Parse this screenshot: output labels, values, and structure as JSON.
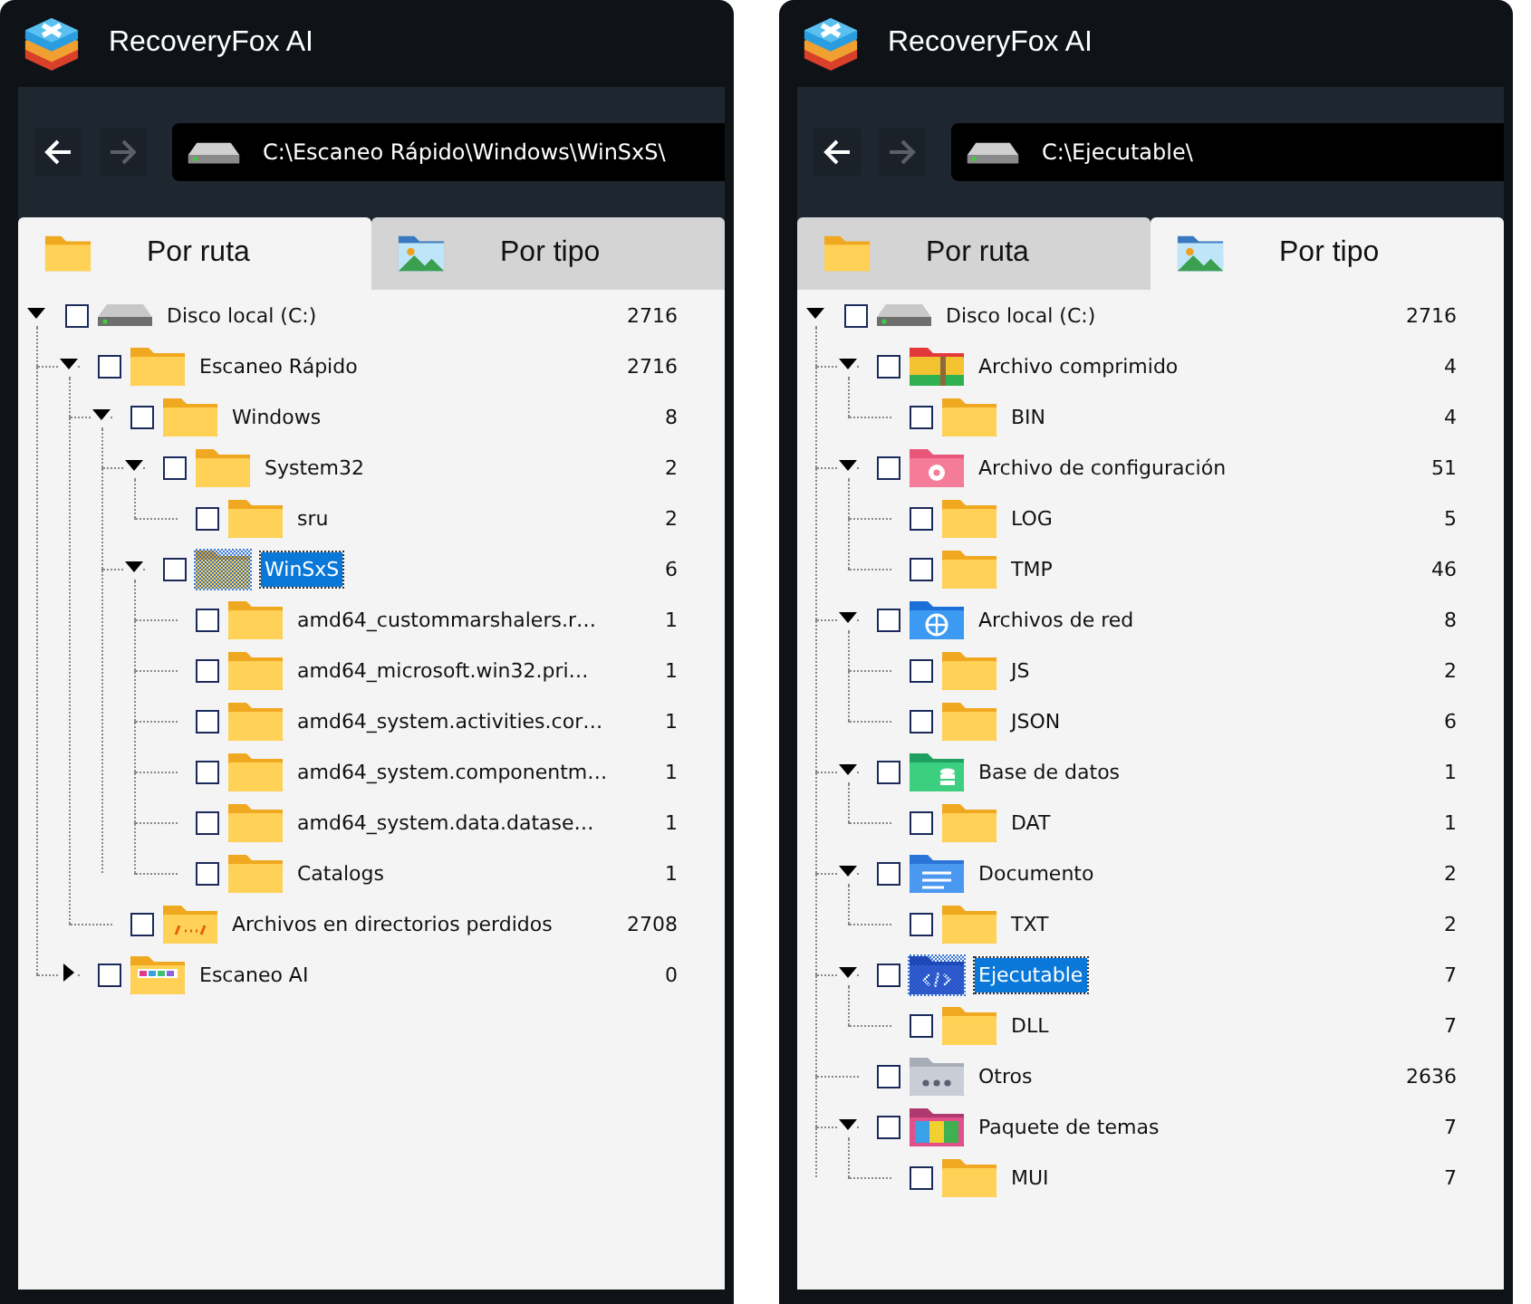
{
  "panels": [
    {
      "window": {
        "title": "RecoveryFox AI"
      },
      "nav": [
        {
          "kind": "back",
          "disabled": false
        },
        {
          "kind": "forward",
          "disabled": true
        }
      ],
      "path": "C:\\Escaneo Rápido\\Windows\\WinSxS\\",
      "tabs": [
        {
          "label": "Por ruta",
          "kind": "folder",
          "selected": true
        },
        {
          "label": "Por tipo",
          "kind": "pictures",
          "selected": false
        }
      ],
      "tree": [
        {
          "label": "Disco local (C:)",
          "count": "2716",
          "kind": "drive",
          "checked": false,
          "selected": false,
          "expanded": true,
          "children": [
            {
              "label": "Escaneo Rápido",
              "count": "2716",
              "kind": "folder",
              "checked": false,
              "selected": false,
              "expanded": true,
              "children": [
                {
                  "label": "Windows",
                  "count": "8",
                  "kind": "folder",
                  "checked": false,
                  "selected": false,
                  "expanded": true,
                  "children": [
                    {
                      "label": "System32",
                      "count": "2",
                      "kind": "folder",
                      "checked": false,
                      "selected": false,
                      "expanded": true,
                      "children": [
                        {
                          "label": "sru",
                          "count": "2",
                          "kind": "folder",
                          "checked": false,
                          "selected": false
                        }
                      ]
                    },
                    {
                      "label": "WinSxS",
                      "count": "6",
                      "kind": "folder",
                      "checked": false,
                      "selected": true,
                      "expanded": true,
                      "children": [
                        {
                          "label": "amd64_custommarshalers.r…",
                          "count": "1",
                          "kind": "folder",
                          "checked": false,
                          "selected": false
                        },
                        {
                          "label": "amd64_microsoft.win32.pri…",
                          "count": "1",
                          "kind": "folder",
                          "checked": false,
                          "selected": false
                        },
                        {
                          "label": "amd64_system.activities.cor…",
                          "count": "1",
                          "kind": "folder",
                          "checked": false,
                          "selected": false
                        },
                        {
                          "label": "amd64_system.componentm…",
                          "count": "1",
                          "kind": "folder",
                          "checked": false,
                          "selected": false
                        },
                        {
                          "label": "amd64_system.data.datase…",
                          "count": "1",
                          "kind": "folder",
                          "checked": false,
                          "selected": false
                        },
                        {
                          "label": "Catalogs",
                          "count": "1",
                          "kind": "folder",
                          "checked": false,
                          "selected": false
                        }
                      ]
                    }
                  ]
                },
                {
                  "label": "Archivos en directorios perdidos",
                  "count": "2708",
                  "kind": "lost",
                  "checked": false,
                  "selected": false
                }
              ]
            },
            {
              "label": "Escaneo AI",
              "count": "0",
              "kind": "ai",
              "checked": false,
              "selected": false,
              "expanded": false
            }
          ]
        }
      ]
    },
    {
      "window": {
        "title": "RecoveryFox AI"
      },
      "nav": [
        {
          "kind": "back",
          "disabled": false
        },
        {
          "kind": "forward",
          "disabled": true
        }
      ],
      "path": "C:\\Ejecutable\\",
      "tabs": [
        {
          "label": "Por ruta",
          "kind": "folder",
          "selected": false
        },
        {
          "label": "Por tipo",
          "kind": "pictures",
          "selected": true
        }
      ],
      "tree": [
        {
          "label": "Disco local (C:)",
          "count": "2716",
          "kind": "drive",
          "checked": false,
          "selected": false,
          "expanded": true,
          "children": [
            {
              "label": "Archivo comprimido",
              "count": "4",
              "kind": "archive",
              "checked": false,
              "selected": false,
              "expanded": true,
              "children": [
                {
                  "label": "BIN",
                  "count": "4",
                  "kind": "folder",
                  "checked": false,
                  "selected": false
                }
              ]
            },
            {
              "label": "Archivo de configuración",
              "count": "51",
              "kind": "config",
              "checked": false,
              "selected": false,
              "expanded": true,
              "children": [
                {
                  "label": "LOG",
                  "count": "5",
                  "kind": "folder",
                  "checked": false,
                  "selected": false
                },
                {
                  "label": "TMP",
                  "count": "46",
                  "kind": "folder",
                  "checked": false,
                  "selected": false
                }
              ]
            },
            {
              "label": "Archivos de red",
              "count": "8",
              "kind": "network",
              "checked": false,
              "selected": false,
              "expanded": true,
              "children": [
                {
                  "label": "JS",
                  "count": "2",
                  "kind": "folder",
                  "checked": false,
                  "selected": false
                },
                {
                  "label": "JSON",
                  "count": "6",
                  "kind": "folder",
                  "checked": false,
                  "selected": false
                }
              ]
            },
            {
              "label": "Base de datos",
              "count": "1",
              "kind": "database",
              "checked": false,
              "selected": false,
              "expanded": true,
              "children": [
                {
                  "label": "DAT",
                  "count": "1",
                  "kind": "folder",
                  "checked": false,
                  "selected": false
                }
              ]
            },
            {
              "label": "Documento",
              "count": "2",
              "kind": "document",
              "checked": false,
              "selected": false,
              "expanded": true,
              "children": [
                {
                  "label": "TXT",
                  "count": "2",
                  "kind": "folder",
                  "checked": false,
                  "selected": false
                }
              ]
            },
            {
              "label": "Ejecutable",
              "count": "7",
              "kind": "executable",
              "checked": false,
              "selected": true,
              "expanded": true,
              "children": [
                {
                  "label": "DLL",
                  "count": "7",
                  "kind": "folder",
                  "checked": false,
                  "selected": false
                }
              ]
            },
            {
              "label": "Otros",
              "count": "2636",
              "kind": "other",
              "checked": false,
              "selected": false
            },
            {
              "label": "Paquete de temas",
              "count": "7",
              "kind": "theme",
              "checked": false,
              "selected": false,
              "expanded": true,
              "children": [
                {
                  "label": "MUI",
                  "count": "7",
                  "kind": "folder",
                  "checked": false,
                  "selected": false
                }
              ]
            }
          ]
        }
      ]
    }
  ]
}
